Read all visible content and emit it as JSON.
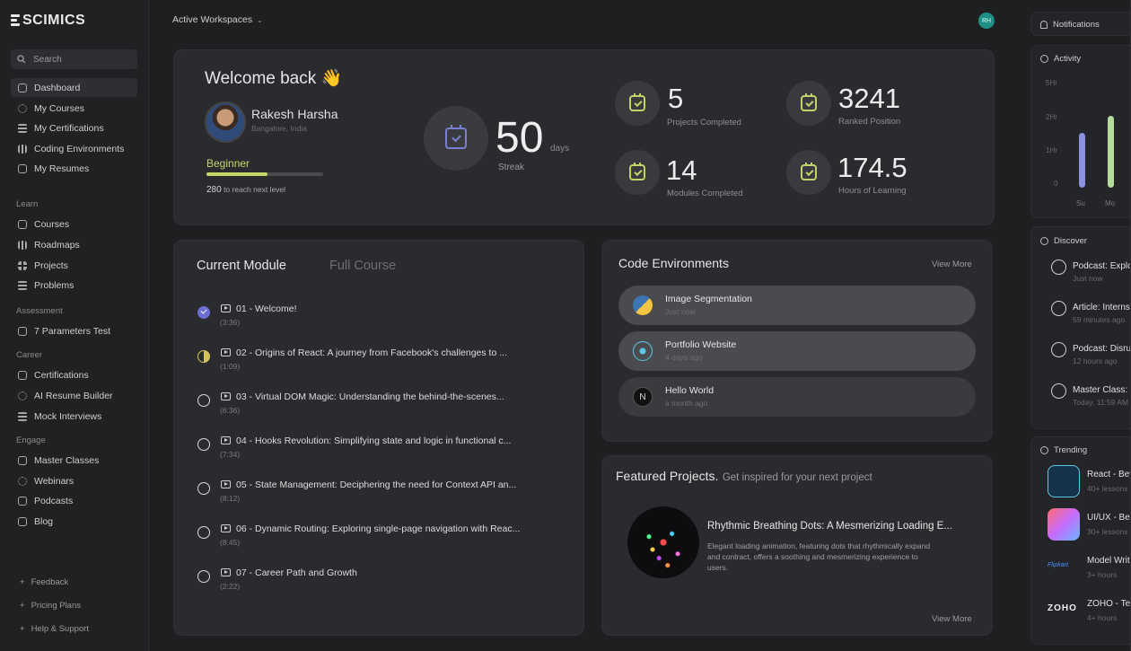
{
  "brand": "SCIMICS",
  "search": {
    "label": "Search"
  },
  "nav_main": [
    {
      "label": "Dashboard",
      "icon": "home-icon"
    },
    {
      "label": "My Courses",
      "icon": "courses-icon"
    },
    {
      "label": "My Certifications",
      "icon": "certifications-icon"
    },
    {
      "label": "Coding Environments",
      "icon": "code-env-icon"
    },
    {
      "label": "My Resumes",
      "icon": "resume-icon"
    }
  ],
  "sections": {
    "learn": "Learn",
    "assessment": "Assessment",
    "career": "Career",
    "engage": "Engage"
  },
  "nav_learn": [
    {
      "label": "Courses"
    },
    {
      "label": "Roadmaps"
    },
    {
      "label": "Projects"
    },
    {
      "label": "Problems"
    }
  ],
  "nav_assessment": [
    {
      "label": "7 Parameters Test"
    }
  ],
  "nav_career": [
    {
      "label": "Certifications"
    },
    {
      "label": "AI Resume Builder"
    },
    {
      "label": "Mock Interviews"
    }
  ],
  "nav_engage": [
    {
      "label": "Master Classes"
    },
    {
      "label": "Webinars"
    },
    {
      "label": "Podcasts"
    },
    {
      "label": "Blog"
    }
  ],
  "footer": [
    {
      "label": "Feedback"
    },
    {
      "label": "Pricing Plans"
    },
    {
      "label": "Help & Support"
    }
  ],
  "topbar": {
    "workspace": "Active Workspaces",
    "avatar_initials": "RH"
  },
  "welcome": {
    "title": "Welcome back 👋",
    "name": "Rakesh Harsha",
    "location": "Bangalore, India",
    "level": "Beginner",
    "level_progress": 0.52,
    "next_points": "280",
    "next_text": "to reach next level",
    "streak": "50",
    "streak_unit": "days",
    "streak_label": "Streak",
    "stats": [
      {
        "value": "5",
        "label": "Projects Completed"
      },
      {
        "value": "3241",
        "label": "Ranked Position"
      },
      {
        "value": "14",
        "label": "Modules Completed"
      },
      {
        "value": "174.5",
        "label": "Hours of Learning"
      }
    ]
  },
  "module": {
    "tab_active": "Current Module",
    "tab_inactive": "Full Course",
    "items": [
      {
        "title": "01 - Welcome!",
        "duration": "(3:36)",
        "status": "done"
      },
      {
        "title": "02 - Origins of React: A journey from Facebook's challenges to ...",
        "duration": "(1:09)",
        "status": "in-progress"
      },
      {
        "title": "03 - Virtual DOM Magic: Understanding the behind-the-scenes...",
        "duration": "(6:36)",
        "status": "todo"
      },
      {
        "title": "04 - Hooks Revolution: Simplifying state and logic in functional c...",
        "duration": "(7:34)",
        "status": "todo"
      },
      {
        "title": "05 - State Management: Deciphering the need for Context API an...",
        "duration": "(8:12)",
        "status": "todo"
      },
      {
        "title": "06 - Dynamic Routing: Exploring single-page navigation with Reac...",
        "duration": "(8:45)",
        "status": "todo"
      },
      {
        "title": "07 - Career Path and Growth",
        "duration": "(2:22)",
        "status": "todo"
      }
    ]
  },
  "code_env": {
    "title": "Code Environments",
    "view_more": "View More",
    "items": [
      {
        "name": "Image Segmentation",
        "time": "Just now",
        "icon": "python-icon"
      },
      {
        "name": "Portfolio Website",
        "time": "4 days ago",
        "icon": "react-icon"
      },
      {
        "name": "Hello World",
        "time": "a month ago",
        "icon": "nextjs-icon"
      }
    ]
  },
  "featured": {
    "title": "Featured Projects.",
    "subtitle": "Get inspired for your next project",
    "project_title": "Rhythmic Breathing Dots: A Mesmerizing Loading E...",
    "project_desc": "Elegant loading animation, featuring dots that rhythmically expand and contract, offers a soothing and mesmerizing experience to users.",
    "view_more": "View More"
  },
  "right": {
    "notifications": "Notifications",
    "activity": "Activity",
    "y_labels": [
      "5Hr",
      "2Hr",
      "1Hr",
      "0"
    ],
    "days": [
      "Su",
      "Mo"
    ],
    "hours": [
      1.6,
      2.1
    ],
    "discover_title": "Discover",
    "discover": [
      {
        "title": "Podcast: Explo",
        "time": "Just now",
        "icon": "podcast-icon"
      },
      {
        "title": "Article: Interns",
        "time": "59 minutes ago",
        "icon": "article-icon"
      },
      {
        "title": "Podcast: Disru",
        "time": "12 hours ago",
        "icon": "podcast-icon"
      },
      {
        "title": "Master Class:",
        "time": "Today, 11:59 AM",
        "icon": "broadcast-icon"
      }
    ],
    "trending_title": "Trending",
    "trending": [
      {
        "title": "React - Bey",
        "sub": "40+ lessons",
        "icon": "react-icon"
      },
      {
        "title": "UI/UX - Bey",
        "sub": "30+ lessons",
        "icon": "uiux-icon"
      },
      {
        "title": "Model Writ",
        "sub": "3+ hours",
        "icon": "flipkart-icon",
        "logo_text": "Flipkart"
      },
      {
        "title": "ZOHO - Tec",
        "sub": "4+ hours",
        "icon": "zoho-icon",
        "logo_text": "ZOHO"
      }
    ]
  },
  "colors": {
    "accent_green": "#c6d66a",
    "accent_purple": "#6b6fd3",
    "bar_purple": "#8b90e0",
    "bar_green": "#b5dc9a"
  }
}
